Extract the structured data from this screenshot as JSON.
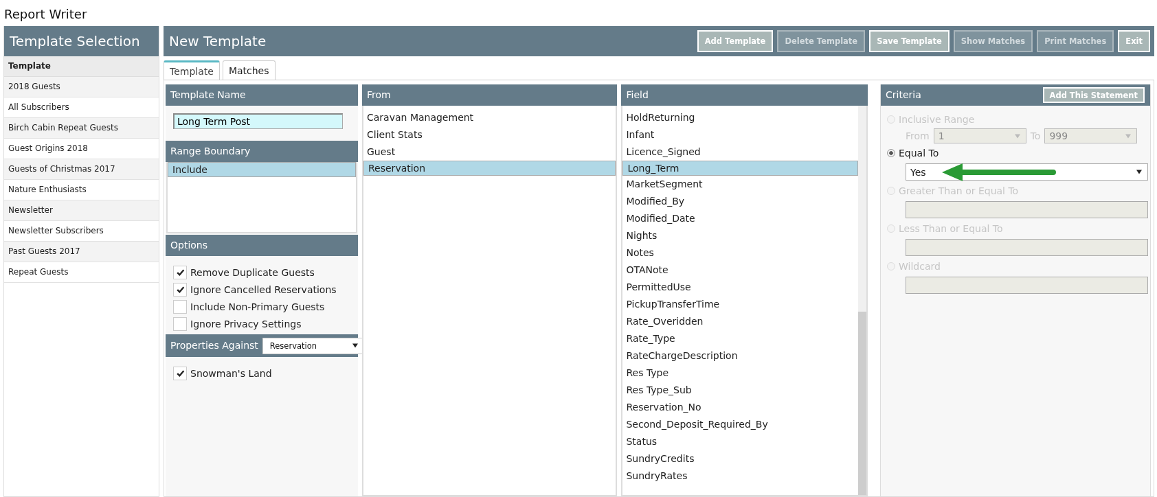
{
  "app_title": "Report Writer",
  "sidebar": {
    "title": "Template Selection",
    "header": "Template",
    "items": [
      {
        "label": "2018 Guests"
      },
      {
        "label": "All Subscribers"
      },
      {
        "label": "Birch Cabin Repeat Guests"
      },
      {
        "label": "Guest Origins 2018"
      },
      {
        "label": "Guests of Christmas 2017"
      },
      {
        "label": "Nature Enthusiasts"
      },
      {
        "label": "Newsletter"
      },
      {
        "label": "Newsletter Subscribers"
      },
      {
        "label": "Past Guests 2017"
      },
      {
        "label": "Repeat Guests"
      }
    ]
  },
  "main": {
    "title": "New Template",
    "buttons": [
      {
        "label": "Add Template",
        "disabled": false
      },
      {
        "label": "Delete Template",
        "disabled": true
      },
      {
        "label": "Save Template",
        "disabled": false
      },
      {
        "label": "Show Matches",
        "disabled": true
      },
      {
        "label": "Print Matches",
        "disabled": true
      },
      {
        "label": "Exit",
        "disabled": false
      }
    ]
  },
  "tabs": [
    {
      "label": "Template",
      "selected": true
    },
    {
      "label": "Matches",
      "selected": false
    }
  ],
  "template_name": {
    "title": "Template Name",
    "value": "Long Term Post"
  },
  "range_boundary": {
    "title": "Range Boundary",
    "items": [
      {
        "label": "Include",
        "selected": true
      }
    ]
  },
  "options": {
    "title": "Options",
    "items": [
      {
        "label": "Remove Duplicate Guests",
        "checked": true
      },
      {
        "label": "Ignore Cancelled Reservations",
        "checked": true
      },
      {
        "label": "Include Non-Primary Guests",
        "checked": false
      },
      {
        "label": "Ignore Privacy Settings",
        "checked": false
      }
    ]
  },
  "properties": {
    "title": "Properties Against",
    "select_value": "Reservation",
    "items": [
      {
        "label": "Snowman's Land",
        "checked": true
      }
    ]
  },
  "from": {
    "title": "From",
    "items": [
      {
        "label": "Caravan Management",
        "selected": false
      },
      {
        "label": "Client Stats",
        "selected": false
      },
      {
        "label": "Guest",
        "selected": false
      },
      {
        "label": "Reservation",
        "selected": true
      }
    ]
  },
  "field": {
    "title": "Field",
    "items": [
      {
        "label": "HoldReturning",
        "selected": false
      },
      {
        "label": "Infant",
        "selected": false
      },
      {
        "label": "Licence_Signed",
        "selected": false
      },
      {
        "label": "Long_Term",
        "selected": true
      },
      {
        "label": "MarketSegment",
        "selected": false
      },
      {
        "label": "Modified_By",
        "selected": false
      },
      {
        "label": "Modified_Date",
        "selected": false
      },
      {
        "label": "Nights",
        "selected": false
      },
      {
        "label": "Notes",
        "selected": false
      },
      {
        "label": "OTANote",
        "selected": false
      },
      {
        "label": "PermittedUse",
        "selected": false
      },
      {
        "label": "PickupTransferTime",
        "selected": false
      },
      {
        "label": "Rate_Overidden",
        "selected": false
      },
      {
        "label": "Rate_Type",
        "selected": false
      },
      {
        "label": "RateChargeDescription",
        "selected": false
      },
      {
        "label": "Res Type",
        "selected": false
      },
      {
        "label": "Res Type_Sub",
        "selected": false
      },
      {
        "label": "Reservation_No",
        "selected": false
      },
      {
        "label": "Second_Deposit_Required_By",
        "selected": false
      },
      {
        "label": "Status",
        "selected": false
      },
      {
        "label": "SundryCredits",
        "selected": false
      },
      {
        "label": "SundryRates",
        "selected": false
      }
    ]
  },
  "criteria": {
    "title": "Criteria",
    "button": "Add This Statement",
    "options": [
      {
        "kind": "range",
        "label": "Inclusive Range",
        "selected": false,
        "disabled": true,
        "from_label": "From",
        "from_value": "1",
        "to_label": "To",
        "to_value": "999"
      },
      {
        "kind": "select",
        "label": "Equal To",
        "selected": true,
        "disabled": false,
        "value": "Yes"
      },
      {
        "kind": "text",
        "label": "Greater Than or Equal To",
        "selected": false,
        "disabled": true
      },
      {
        "kind": "text",
        "label": "Less Than or Equal To",
        "selected": false,
        "disabled": true
      },
      {
        "kind": "text",
        "label": "Wildcard",
        "selected": false,
        "disabled": true
      }
    ]
  }
}
